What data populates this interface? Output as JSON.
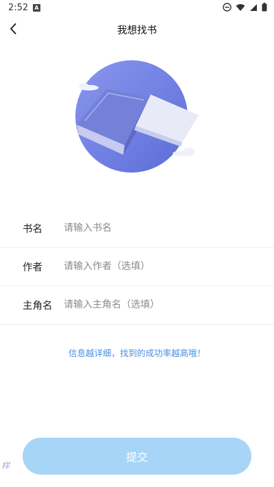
{
  "status_bar": {
    "time": "2:52",
    "app_icon_letter": "A"
  },
  "header": {
    "title": "我想找书",
    "back_icon": "chevron-left-icon"
  },
  "form": {
    "fields": [
      {
        "label": "书名",
        "placeholder": "请输入书名"
      },
      {
        "label": "作者",
        "placeholder": "请输入作者（选填）"
      },
      {
        "label": "主角名",
        "placeholder": "请输入主角名（选填）"
      }
    ]
  },
  "tip": "信息越详细，找到的成功率越高哦！",
  "submit_label": "提交",
  "watermark": "样",
  "colors": {
    "tip": "#4a8ee0",
    "button": "#a6d5f8",
    "circle": "#6e7fe0"
  }
}
